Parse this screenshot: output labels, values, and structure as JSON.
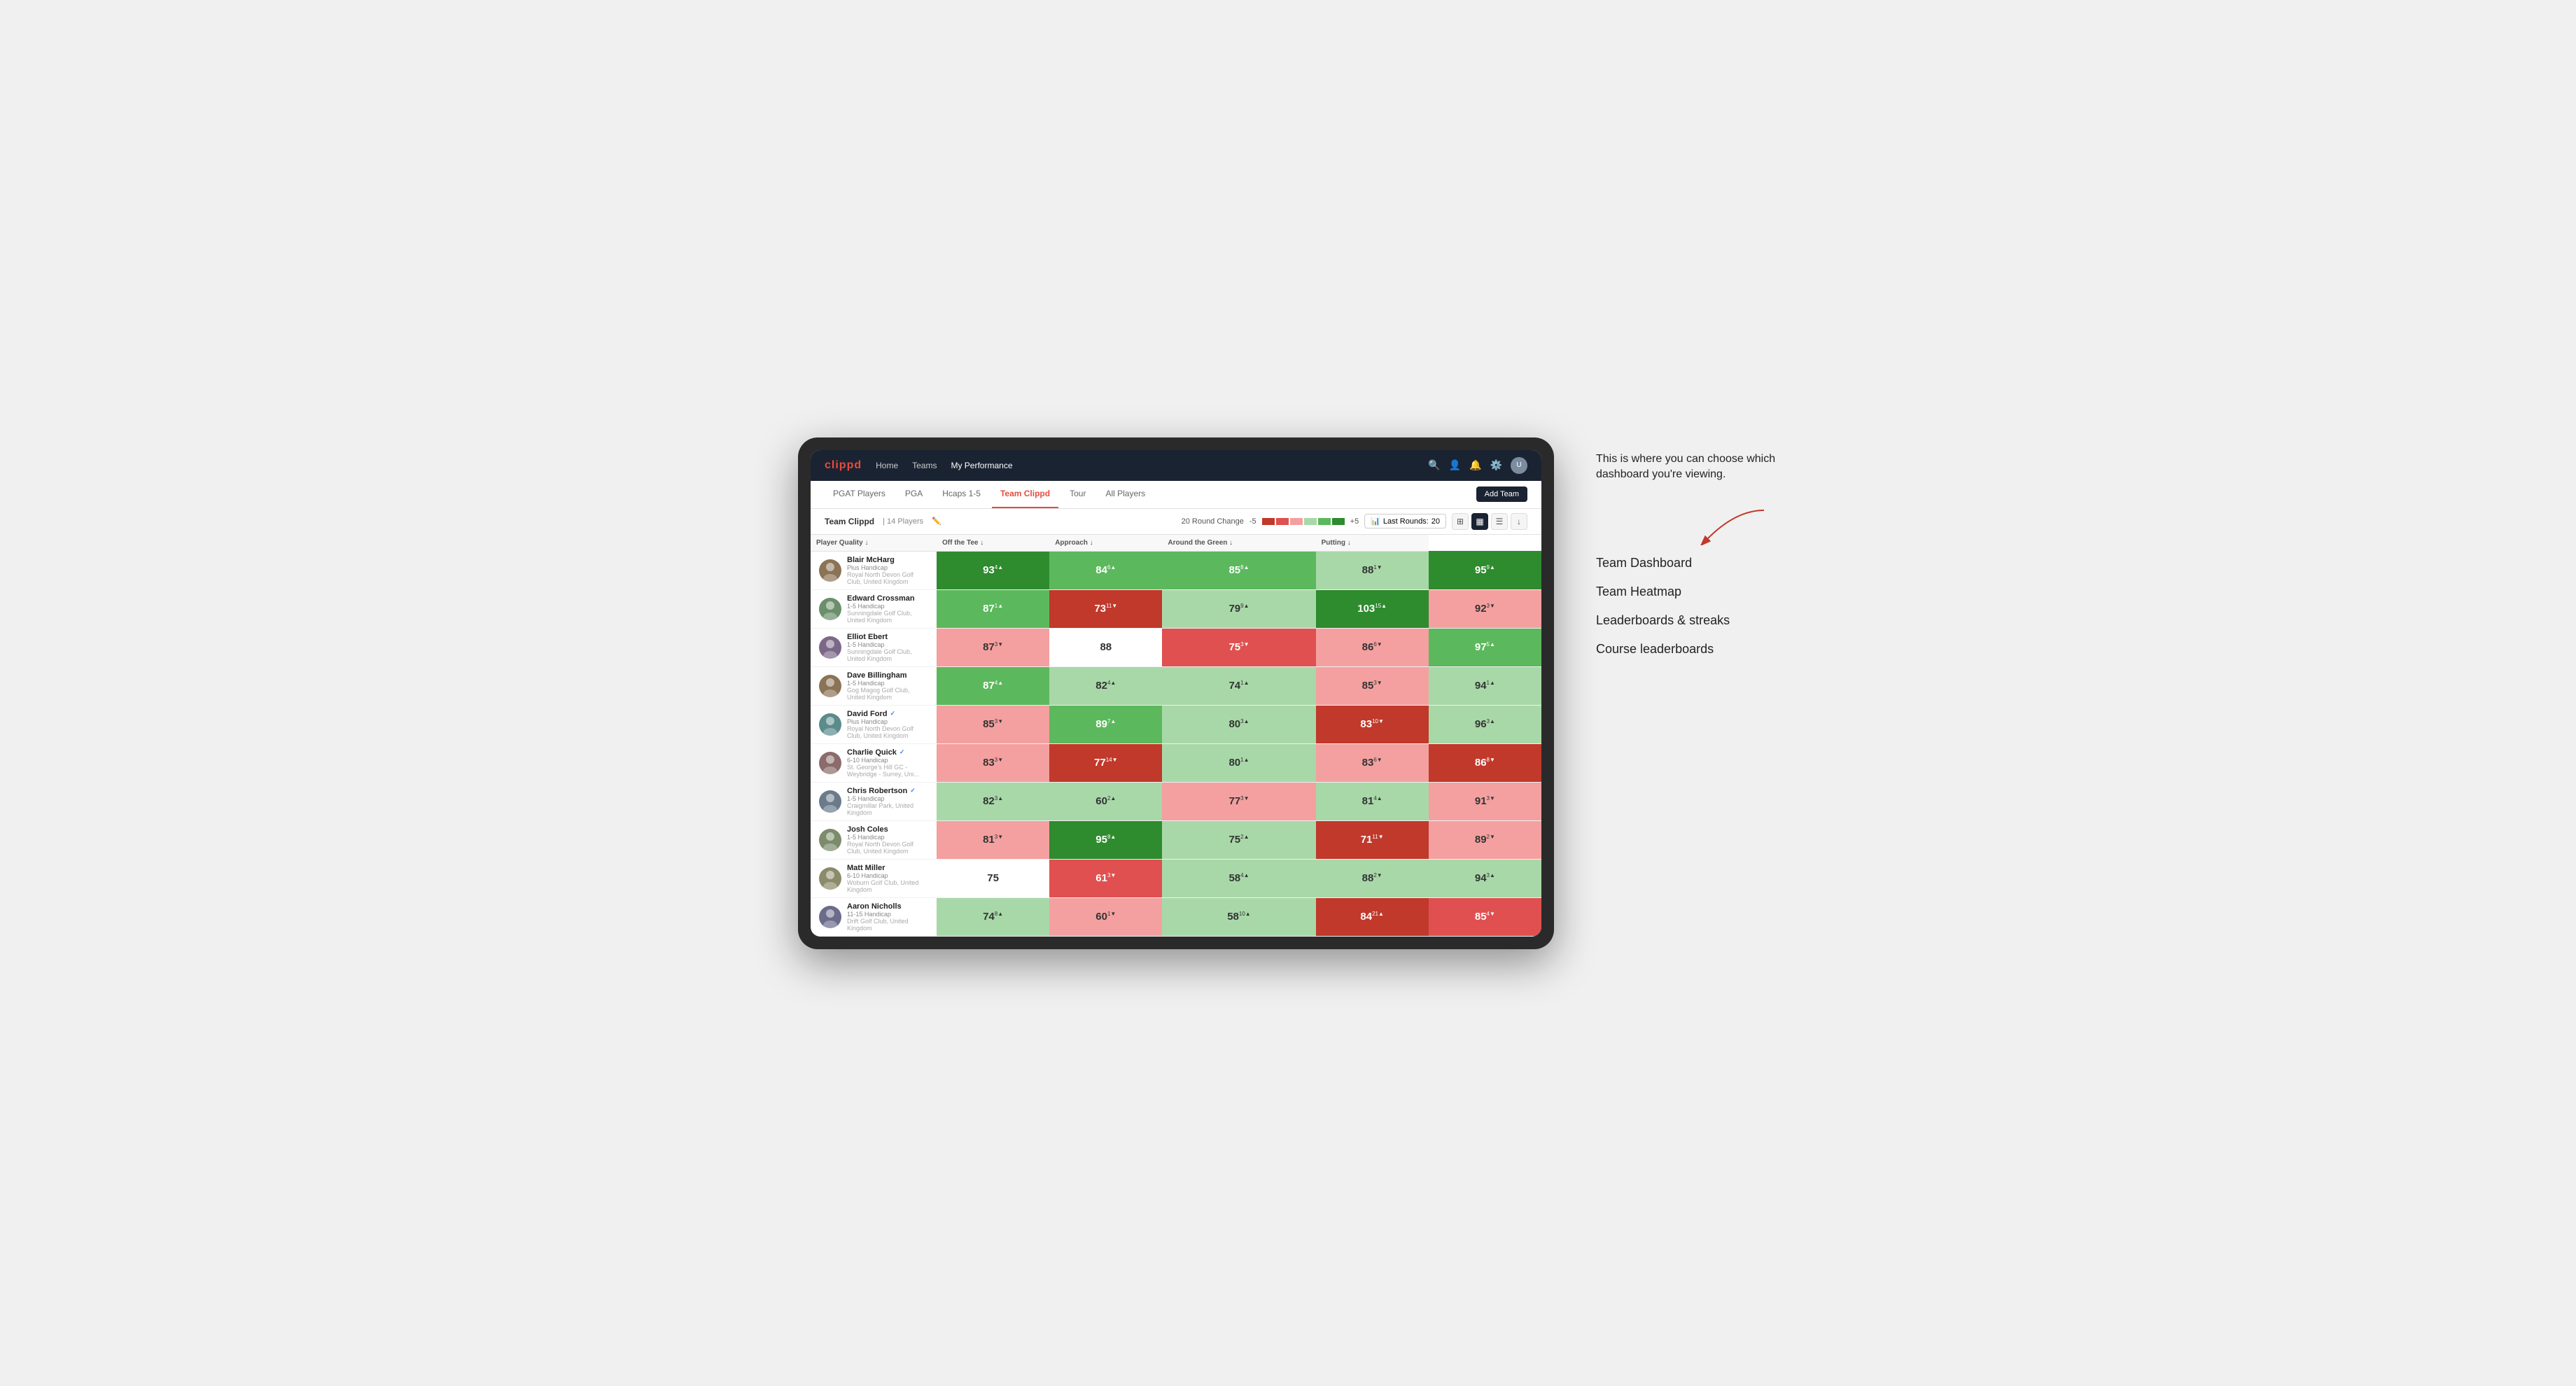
{
  "app": {
    "logo": "clippd",
    "nav_links": [
      "Home",
      "Teams",
      "My Performance"
    ],
    "nav_active": "My Performance"
  },
  "tabs": [
    "PGAT Players",
    "PGA",
    "Hcaps 1-5",
    "Team Clippd",
    "Tour",
    "All Players"
  ],
  "active_tab": "Team Clippd",
  "add_team_label": "Add Team",
  "sub_header": {
    "team_name": "Team Clippd",
    "player_count": "14 Players",
    "round_change_label": "20 Round Change",
    "minus_val": "-5",
    "plus_val": "+5",
    "last_rounds_label": "Last Rounds:",
    "last_rounds_val": "20"
  },
  "column_headers": [
    {
      "id": "player",
      "label": "Player Quality ↓"
    },
    {
      "id": "tee",
      "label": "Off the Tee ↓"
    },
    {
      "id": "approach",
      "label": "Approach ↓"
    },
    {
      "id": "around",
      "label": "Around the Green ↓"
    },
    {
      "id": "putting",
      "label": "Putting ↓"
    }
  ],
  "players": [
    {
      "name": "Blair McHarg",
      "handicap": "Plus Handicap",
      "club": "Royal North Devon Golf Club, United Kingdom",
      "verified": false,
      "scores": [
        {
          "val": "93",
          "change": "4▲",
          "color": "green-dark"
        },
        {
          "val": "84",
          "change": "6▲",
          "color": "green-mid"
        },
        {
          "val": "85",
          "change": "8▲",
          "color": "green-mid"
        },
        {
          "val": "88",
          "change": "1▼",
          "color": "green-light"
        },
        {
          "val": "95",
          "change": "9▲",
          "color": "green-dark"
        }
      ]
    },
    {
      "name": "Edward Crossman",
      "handicap": "1-5 Handicap",
      "club": "Sunningdale Golf Club, United Kingdom",
      "verified": false,
      "scores": [
        {
          "val": "87",
          "change": "1▲",
          "color": "green-mid"
        },
        {
          "val": "73",
          "change": "11▼",
          "color": "red-dark"
        },
        {
          "val": "79",
          "change": "9▲",
          "color": "green-light"
        },
        {
          "val": "103",
          "change": "15▲",
          "color": "green-dark"
        },
        {
          "val": "92",
          "change": "3▼",
          "color": "red-light"
        }
      ]
    },
    {
      "name": "Elliot Ebert",
      "handicap": "1-5 Handicap",
      "club": "Sunningdale Golf Club, United Kingdom",
      "verified": false,
      "scores": [
        {
          "val": "87",
          "change": "3▼",
          "color": "red-light"
        },
        {
          "val": "88",
          "change": "",
          "color": "white-bg"
        },
        {
          "val": "75",
          "change": "3▼",
          "color": "red-mid"
        },
        {
          "val": "86",
          "change": "6▼",
          "color": "red-light"
        },
        {
          "val": "97",
          "change": "5▲",
          "color": "green-mid"
        }
      ]
    },
    {
      "name": "Dave Billingham",
      "handicap": "1-5 Handicap",
      "club": "Gog Magog Golf Club, United Kingdom",
      "verified": false,
      "scores": [
        {
          "val": "87",
          "change": "4▲",
          "color": "green-mid"
        },
        {
          "val": "82",
          "change": "4▲",
          "color": "green-light"
        },
        {
          "val": "74",
          "change": "1▲",
          "color": "green-light"
        },
        {
          "val": "85",
          "change": "3▼",
          "color": "red-light"
        },
        {
          "val": "94",
          "change": "1▲",
          "color": "green-light"
        }
      ]
    },
    {
      "name": "David Ford",
      "handicap": "Plus Handicap",
      "club": "Royal North Devon Golf Club, United Kingdom",
      "verified": true,
      "scores": [
        {
          "val": "85",
          "change": "3▼",
          "color": "red-light"
        },
        {
          "val": "89",
          "change": "7▲",
          "color": "green-mid"
        },
        {
          "val": "80",
          "change": "3▲",
          "color": "green-light"
        },
        {
          "val": "83",
          "change": "10▼",
          "color": "red-dark"
        },
        {
          "val": "96",
          "change": "3▲",
          "color": "green-light"
        }
      ]
    },
    {
      "name": "Charlie Quick",
      "handicap": "6-10 Handicap",
      "club": "St. George's Hill GC - Weybridge - Surrey, Uni...",
      "verified": true,
      "scores": [
        {
          "val": "83",
          "change": "3▼",
          "color": "red-light"
        },
        {
          "val": "77",
          "change": "14▼",
          "color": "red-dark"
        },
        {
          "val": "80",
          "change": "1▲",
          "color": "green-light"
        },
        {
          "val": "83",
          "change": "6▼",
          "color": "red-light"
        },
        {
          "val": "86",
          "change": "8▼",
          "color": "red-dark"
        }
      ]
    },
    {
      "name": "Chris Robertson",
      "handicap": "1-5 Handicap",
      "club": "Craigmillar Park, United Kingdom",
      "verified": true,
      "scores": [
        {
          "val": "82",
          "change": "3▲",
          "color": "green-light"
        },
        {
          "val": "60",
          "change": "2▲",
          "color": "green-light"
        },
        {
          "val": "77",
          "change": "3▼",
          "color": "red-light"
        },
        {
          "val": "81",
          "change": "4▲",
          "color": "green-light"
        },
        {
          "val": "91",
          "change": "3▼",
          "color": "red-light"
        }
      ]
    },
    {
      "name": "Josh Coles",
      "handicap": "1-5 Handicap",
      "club": "Royal North Devon Golf Club, United Kingdom",
      "verified": false,
      "scores": [
        {
          "val": "81",
          "change": "3▼",
          "color": "red-light"
        },
        {
          "val": "95",
          "change": "8▲",
          "color": "green-dark"
        },
        {
          "val": "75",
          "change": "2▲",
          "color": "green-light"
        },
        {
          "val": "71",
          "change": "11▼",
          "color": "red-dark"
        },
        {
          "val": "89",
          "change": "2▼",
          "color": "red-light"
        }
      ]
    },
    {
      "name": "Matt Miller",
      "handicap": "6-10 Handicap",
      "club": "Woburn Golf Club, United Kingdom",
      "verified": false,
      "scores": [
        {
          "val": "75",
          "change": "",
          "color": "white-bg"
        },
        {
          "val": "61",
          "change": "3▼",
          "color": "red-mid"
        },
        {
          "val": "58",
          "change": "4▲",
          "color": "green-light"
        },
        {
          "val": "88",
          "change": "2▼",
          "color": "green-light"
        },
        {
          "val": "94",
          "change": "3▲",
          "color": "green-light"
        }
      ]
    },
    {
      "name": "Aaron Nicholls",
      "handicap": "11-15 Handicap",
      "club": "Drift Golf Club, United Kingdom",
      "verified": false,
      "scores": [
        {
          "val": "74",
          "change": "8▲",
          "color": "green-light"
        },
        {
          "val": "60",
          "change": "1▼",
          "color": "red-light"
        },
        {
          "val": "58",
          "change": "10▲",
          "color": "green-light"
        },
        {
          "val": "84",
          "change": "21▲",
          "color": "red-dark"
        },
        {
          "val": "85",
          "change": "4▼",
          "color": "red-mid"
        }
      ]
    }
  ],
  "annotation": {
    "callout": "This is where you can choose which dashboard you're viewing.",
    "items": [
      "Team Dashboard",
      "Team Heatmap",
      "Leaderboards & streaks",
      "Course leaderboards"
    ]
  }
}
